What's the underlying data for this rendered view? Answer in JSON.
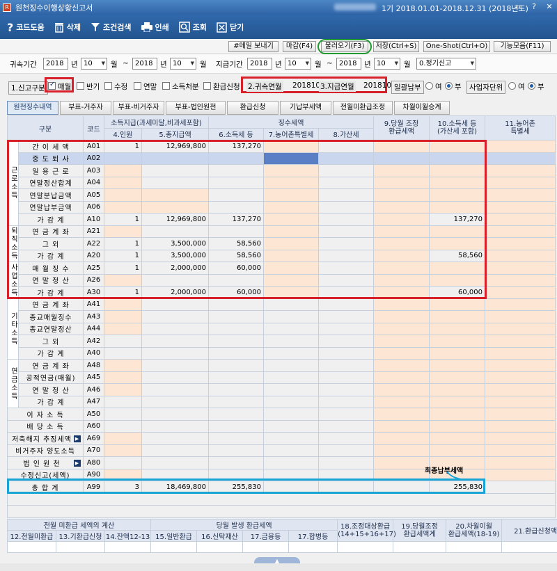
{
  "window": {
    "title": "원천징수이행상황신고서",
    "period": "1기 2018.01.01-2018.12.31 (2018년도)"
  },
  "toolbar": {
    "help": "코드도움",
    "delete": "삭제",
    "search": "조건검색",
    "print": "인쇄",
    "view": "조회",
    "close": "닫기"
  },
  "buttons": {
    "email": "#메일 보내기",
    "deadline": "마감(F4)",
    "load": "불러오기(F3)",
    "save": "저장(Ctrl+S)",
    "oneshot": "One-Shot(Ctrl+O)",
    "functions": "기능모음(F11)"
  },
  "filters": {
    "attr_label": "귀속기간",
    "pay_label": "지급기간",
    "attr_from_year": "2018",
    "attr_from_month": "10",
    "attr_to_year": "2018",
    "attr_to_month": "10",
    "pay_from_year": "2018",
    "pay_from_month": "10",
    "pay_to_year": "2018",
    "pay_to_month": "10",
    "year": "년",
    "month": "월",
    "tilde": "~",
    "report_type": "0.정기신고"
  },
  "options": {
    "report_kind": "1.신고구분",
    "monthly": "매월",
    "half": "반기",
    "amend": "수정",
    "annual": "연말",
    "disposal": "소득처분",
    "refund": "환급신청",
    "attr_month_label": "2.귀속연월",
    "attr_month": "201810",
    "pay_month_label": "3.지급연월",
    "pay_month": "201810",
    "batch": "일괄납부",
    "yes": "여",
    "no": "부",
    "unit": "사업자단위"
  },
  "tabs": [
    "원천징수내역",
    "부표-거주자",
    "부표-비거주자",
    "부표-법인원천",
    "환급신청",
    "기납부세액",
    "전월미환급조정",
    "차월이월승계"
  ],
  "headers": {
    "category": "구분",
    "code": "코드",
    "income_pay": "소득지급(과세미달,비과세포함)",
    "withholding": "징수세액",
    "c4": "4.인원",
    "c5": "5.총지급액",
    "c6": "6.소득세 등",
    "c7": "7.농어촌특별세",
    "c8": "8.가산세",
    "c9": "9.당월 조정\n환급세액",
    "c10": "10.소득세 등\n(가산세 포함)",
    "c11": "11.농어촌\n특별세"
  },
  "groups": {
    "labor": "근로소득",
    "retire": "퇴직소득",
    "business": "사업소득",
    "other": "기타소득",
    "pension": "연금소득"
  },
  "rows": [
    {
      "name": "간 이 세 액",
      "code": "A01",
      "c4": "1",
      "c5": "12,969,800",
      "c6": "137,270",
      "c10": ""
    },
    {
      "name": "중 도 퇴 사",
      "code": "A02",
      "c4": "",
      "c5": "",
      "c6": "",
      "c10": ""
    },
    {
      "name": "일 용 근 로",
      "code": "A03",
      "c4": "",
      "c5": "",
      "c6": "",
      "c10": ""
    },
    {
      "name": "연말정산합계",
      "code": "A04",
      "c4": "",
      "c5": "",
      "c6": "",
      "c10": ""
    },
    {
      "name": "연말분납금액",
      "code": "A05",
      "c4": "",
      "c5": "",
      "c6": "",
      "c10": ""
    },
    {
      "name": "연말납부금액",
      "code": "A06",
      "c4": "",
      "c5": "",
      "c6": "",
      "c10": ""
    },
    {
      "name": "가 감 계",
      "code": "A10",
      "c4": "1",
      "c5": "12,969,800",
      "c6": "137,270",
      "c10": "137,270"
    },
    {
      "name": "연 금 계 좌",
      "code": "A21",
      "c4": "",
      "c5": "",
      "c6": "",
      "c10": ""
    },
    {
      "name": "그 외",
      "code": "A22",
      "c4": "1",
      "c5": "3,500,000",
      "c6": "58,560",
      "c10": ""
    },
    {
      "name": "가 감 계",
      "code": "A20",
      "c4": "1",
      "c5": "3,500,000",
      "c6": "58,560",
      "c10": "58,560"
    },
    {
      "name": "매 월 징 수",
      "code": "A25",
      "c4": "1",
      "c5": "2,000,000",
      "c6": "60,000",
      "c10": ""
    },
    {
      "name": "연 말 정 산",
      "code": "A26",
      "c4": "",
      "c5": "",
      "c6": "",
      "c10": ""
    },
    {
      "name": "가 감 계",
      "code": "A30",
      "c4": "1",
      "c5": "2,000,000",
      "c6": "60,000",
      "c10": "60,000"
    },
    {
      "name": "연 금 계 좌",
      "code": "A41",
      "c4": "",
      "c5": "",
      "c6": "",
      "c10": ""
    },
    {
      "name": "종교매월징수",
      "code": "A43",
      "c4": "",
      "c5": "",
      "c6": "",
      "c10": ""
    },
    {
      "name": "종교연말정산",
      "code": "A44",
      "c4": "",
      "c5": "",
      "c6": "",
      "c10": ""
    },
    {
      "name": "그 외",
      "code": "A42",
      "c4": "",
      "c5": "",
      "c6": "",
      "c10": ""
    },
    {
      "name": "가 감 계",
      "code": "A40",
      "c4": "",
      "c5": "",
      "c6": "",
      "c10": ""
    },
    {
      "name": "연 금 계 좌",
      "code": "A48",
      "c4": "",
      "c5": "",
      "c6": "",
      "c10": ""
    },
    {
      "name": "공적연금(매월)",
      "code": "A45",
      "c4": "",
      "c5": "",
      "c6": "",
      "c10": ""
    },
    {
      "name": "연 말 정 산",
      "code": "A46",
      "c4": "",
      "c5": "",
      "c6": "",
      "c10": ""
    },
    {
      "name": "가 감 계",
      "code": "A47",
      "c4": "",
      "c5": "",
      "c6": "",
      "c10": ""
    },
    {
      "name": "이 자 소 득",
      "code": "A50",
      "c4": "",
      "c5": "",
      "c6": "",
      "c10": ""
    },
    {
      "name": "배 당 소 득",
      "code": "A60",
      "c4": "",
      "c5": "",
      "c6": "",
      "c10": ""
    },
    {
      "name": "저축해지 추징세액",
      "code": "A69",
      "c4": "",
      "c5": "",
      "c6": "",
      "c10": ""
    },
    {
      "name": "비거주자 양도소득",
      "code": "A70",
      "c4": "",
      "c5": "",
      "c6": "",
      "c10": ""
    },
    {
      "name": "법 인 원 천",
      "code": "A80",
      "c4": "",
      "c5": "",
      "c6": "",
      "c10": ""
    },
    {
      "name": "수정신고(세액)",
      "code": "A90",
      "c4": "",
      "c5": "",
      "c6": "",
      "c10": ""
    },
    {
      "name": "총 합 계",
      "code": "A99",
      "c4": "3",
      "c5": "18,469,800",
      "c6": "255,830",
      "c10": "255,830"
    }
  ],
  "annotation": "최종납부세액",
  "bottom": {
    "h1": "전월 미환급 세액의 계산",
    "h2": "당월 발생 환급세액",
    "h3": "18.조정대상환급\n(14+15+16+17)",
    "h4": "19.당월조정\n환급세액계",
    "h5": "20.차월이월\n환급세액(18-19)",
    "h6": "21.환급신청액",
    "c12": "12.전월미환급",
    "c13": "13.기환급신청",
    "c14": "14.잔액12-13",
    "c15": "15.일반환급",
    "c16": "16.신탁재산",
    "c17": "17.금융등",
    "c17b": "17.합병등"
  },
  "colors": {
    "header": "#dfe6f1",
    "peach": "#fde6d3",
    "red_box": "#d8202a",
    "green_circle": "#1e9a2e",
    "blue_box": "#1aa3d6"
  }
}
